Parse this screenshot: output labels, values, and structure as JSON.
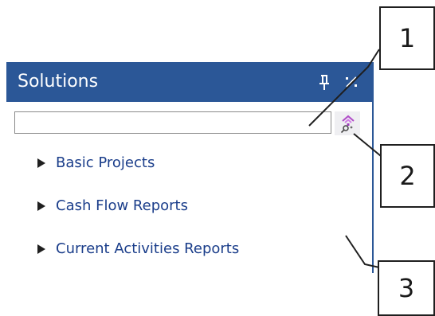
{
  "panel": {
    "title": "Solutions",
    "pin_icon": "pin-icon",
    "close_icon": "close-icon",
    "search": {
      "value": "",
      "placeholder": "",
      "button_icon": "search-icon"
    },
    "items": [
      {
        "label": "Basic Projects",
        "icon": "expand-arrow-icon"
      },
      {
        "label": "Cash Flow Reports",
        "icon": "expand-arrow-icon"
      },
      {
        "label": "Current Activities Reports",
        "icon": "expand-arrow-icon"
      }
    ]
  },
  "callouts": [
    {
      "number": "1"
    },
    {
      "number": "2"
    },
    {
      "number": "3"
    }
  ],
  "colors": {
    "header": "#2b5797",
    "item_text": "#1a3d8a",
    "search_icon_accent": "#b04cc8"
  }
}
